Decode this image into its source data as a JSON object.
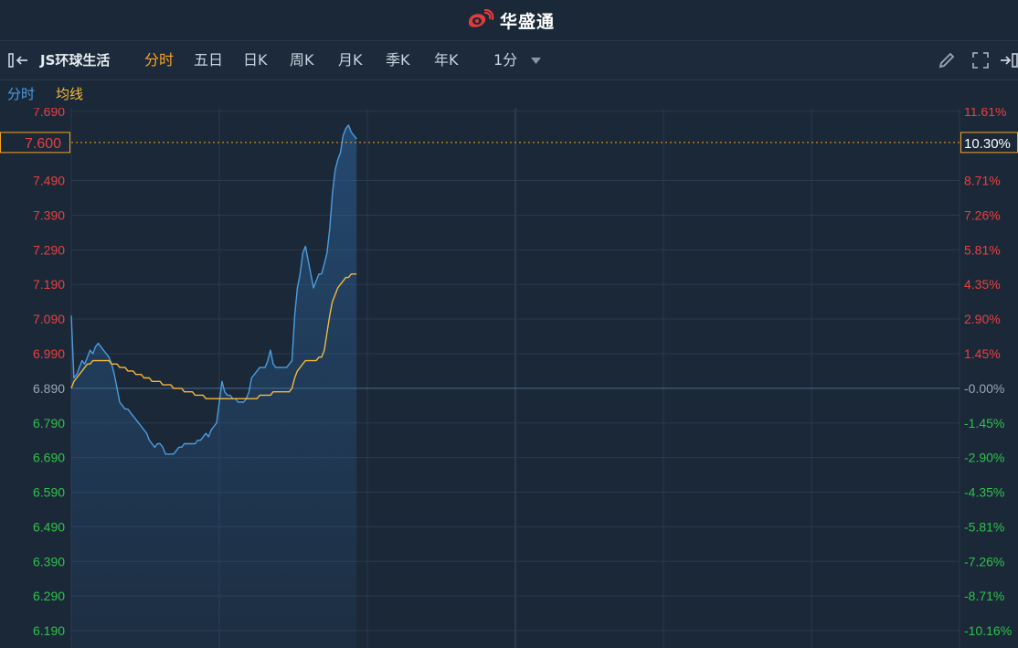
{
  "header": {
    "brand": "华盛通"
  },
  "toolbar": {
    "stock_name": "JS环球生活",
    "tabs": [
      {
        "label": "分时",
        "active": true
      },
      {
        "label": "五日",
        "active": false
      },
      {
        "label": "日K",
        "active": false
      },
      {
        "label": "周K",
        "active": false
      },
      {
        "label": "月K",
        "active": false
      },
      {
        "label": "季K",
        "active": false
      },
      {
        "label": "年K",
        "active": false
      }
    ],
    "interval": "1分"
  },
  "legend": {
    "price_label": "分时",
    "avg_label": "均线"
  },
  "colors": {
    "price_line": "#4a9de0",
    "avg_line": "#f5b93b",
    "up": "#e84040",
    "down": "#2ec24a",
    "neutral": "#9aa6b4",
    "highlight": "#f5a623"
  },
  "chart_data": {
    "type": "line",
    "prev_close": 6.89,
    "ylim": [
      6.14,
      7.7
    ],
    "y_ticks": [
      "7.690",
      "7.490",
      "7.390",
      "7.290",
      "7.190",
      "7.090",
      "6.990",
      "6.890",
      "6.790",
      "6.690",
      "6.590",
      "6.490",
      "6.390",
      "6.290",
      "6.190"
    ],
    "pct_ticks": [
      "11.61%",
      "8.71%",
      "7.26%",
      "5.81%",
      "4.35%",
      "2.90%",
      "1.45%",
      "-0.00%",
      "-1.45%",
      "-2.90%",
      "-4.35%",
      "-5.81%",
      "-7.26%",
      "-8.71%",
      "-10.16%"
    ],
    "current_price": "7.600",
    "current_pct": "10.30%",
    "total_minutes": 330,
    "series": [
      {
        "values": [
          7.1,
          6.92,
          6.93,
          6.95,
          6.97,
          6.96,
          6.98,
          7.0,
          6.99,
          7.01,
          7.02,
          7.01,
          7.0,
          6.99,
          6.98,
          6.96,
          6.93,
          6.89,
          6.85,
          6.84,
          6.83,
          6.83,
          6.82,
          6.81,
          6.8,
          6.79,
          6.78,
          6.77,
          6.76,
          6.74,
          6.73,
          6.72,
          6.73,
          6.73,
          6.72,
          6.7,
          6.7,
          6.7,
          6.7,
          6.71,
          6.72,
          6.72,
          6.73,
          6.73,
          6.73,
          6.73,
          6.73,
          6.74,
          6.74,
          6.75,
          6.76,
          6.75,
          6.77,
          6.78,
          6.79,
          6.85,
          6.91,
          6.88,
          6.87,
          6.87,
          6.86,
          6.86,
          6.85,
          6.85,
          6.85,
          6.86,
          6.88,
          6.92,
          6.93,
          6.94,
          6.95,
          6.95,
          6.95,
          6.97,
          7.0,
          6.96,
          6.95,
          6.95,
          6.95,
          6.95,
          6.95,
          6.96,
          6.97,
          7.1,
          7.18,
          7.22,
          7.28,
          7.3,
          7.26,
          7.22,
          7.18,
          7.2,
          7.22,
          7.22,
          7.25,
          7.28,
          7.35,
          7.45,
          7.52,
          7.55,
          7.57,
          7.62,
          7.64,
          7.65,
          7.63,
          7.62,
          7.61
        ],
        "color": "#4a9de0"
      },
      {
        "values": [
          6.89,
          6.91,
          6.92,
          6.93,
          6.94,
          6.95,
          6.96,
          6.96,
          6.97,
          6.97,
          6.97,
          6.97,
          6.97,
          6.97,
          6.97,
          6.96,
          6.96,
          6.96,
          6.95,
          6.95,
          6.95,
          6.94,
          6.94,
          6.94,
          6.93,
          6.93,
          6.93,
          6.92,
          6.92,
          6.92,
          6.91,
          6.91,
          6.91,
          6.91,
          6.9,
          6.9,
          6.9,
          6.9,
          6.89,
          6.89,
          6.89,
          6.89,
          6.88,
          6.88,
          6.88,
          6.88,
          6.87,
          6.87,
          6.87,
          6.87,
          6.86,
          6.86,
          6.86,
          6.86,
          6.86,
          6.86,
          6.86,
          6.86,
          6.86,
          6.86,
          6.86,
          6.86,
          6.86,
          6.86,
          6.86,
          6.86,
          6.86,
          6.86,
          6.86,
          6.86,
          6.87,
          6.87,
          6.87,
          6.87,
          6.87,
          6.88,
          6.88,
          6.88,
          6.88,
          6.88,
          6.88,
          6.88,
          6.89,
          6.92,
          6.94,
          6.95,
          6.96,
          6.97,
          6.97,
          6.97,
          6.97,
          6.97,
          6.98,
          6.98,
          7.0,
          7.05,
          7.1,
          7.14,
          7.16,
          7.18,
          7.19,
          7.2,
          7.21,
          7.21,
          7.22,
          7.22,
          7.22
        ],
        "color": "#f5b93b"
      }
    ],
    "grid": true
  }
}
